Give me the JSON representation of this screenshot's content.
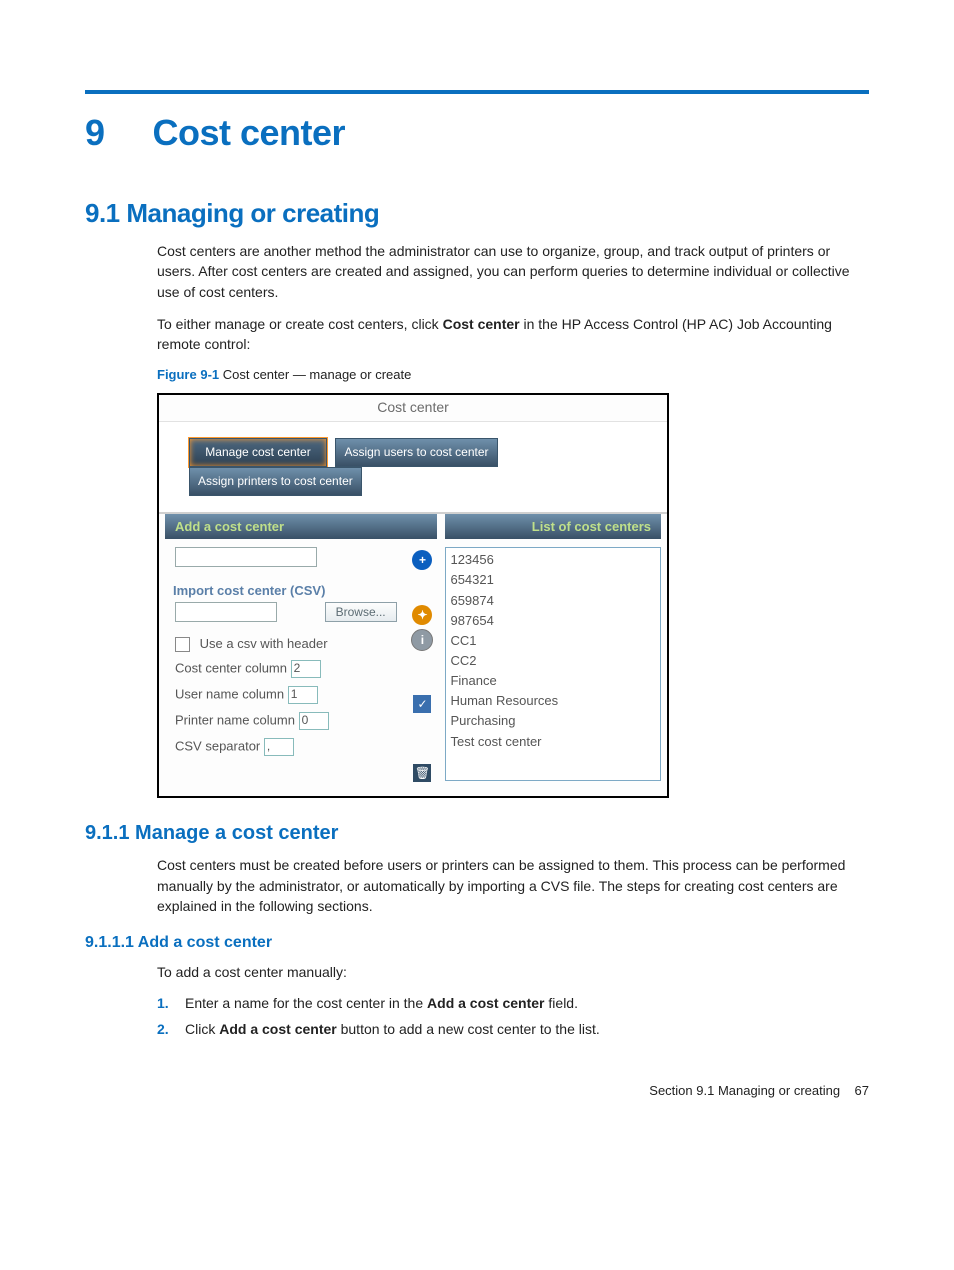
{
  "chapter": {
    "number": "9",
    "title": "Cost center"
  },
  "section_9_1": {
    "heading": "9.1 Managing or creating",
    "p1": "Cost centers are another method the administrator can use to organize, group, and track output of printers or users. After cost centers are created and assigned, you can perform queries to determine individual or collective use of cost centers.",
    "p2_a": "To either manage or create cost centers, click ",
    "p2_bold": "Cost center",
    "p2_b": " in the HP Access Control (HP AC) Job Accounting remote control:"
  },
  "figure": {
    "label": "Figure 9-1",
    "rest": "  Cost center — manage or create"
  },
  "screenshot": {
    "title": "Cost center",
    "tabs": {
      "manage": "Manage cost center",
      "assign_users": "Assign users to cost center",
      "assign_printers": "Assign printers to cost center"
    },
    "left_header": "Add a cost center",
    "right_header": "List of cost centers",
    "import_title": "Import cost center (CSV)",
    "browse": "Browse...",
    "use_csv_header": "Use a csv with header",
    "cost_center_column_label": "Cost center column",
    "cost_center_column_value": "2",
    "user_name_column_label": "User name column",
    "user_name_column_value": "1",
    "printer_name_column_label": "Printer name column",
    "printer_name_column_value": "0",
    "csv_separator_label": "CSV separator",
    "csv_separator_value": ",",
    "list_items": [
      "123456",
      "654321",
      "659874",
      "987654",
      "CC1",
      "CC2",
      "Finance",
      "Human Resources",
      "Purchasing",
      "Test cost center"
    ]
  },
  "section_9_1_1": {
    "heading": "9.1.1 Manage a cost center",
    "p": "Cost centers must be created before users or printers can be assigned to them. This process can be performed manually by the administrator, or automatically by importing a CVS file. The steps for creating cost centers are explained in the following sections."
  },
  "section_9_1_1_1": {
    "heading": "9.1.1.1 Add a cost center",
    "intro": "To add a cost center manually:",
    "steps": [
      {
        "n": "1.",
        "a": "Enter a name for the cost center in the ",
        "bold": "Add a cost center",
        "b": " field."
      },
      {
        "n": "2.",
        "a": "Click ",
        "bold": "Add a cost center",
        "b": " button to add a new cost center to the list."
      }
    ]
  },
  "footer": {
    "section_ref": "Section 9.1   Managing or creating",
    "page": "67"
  }
}
